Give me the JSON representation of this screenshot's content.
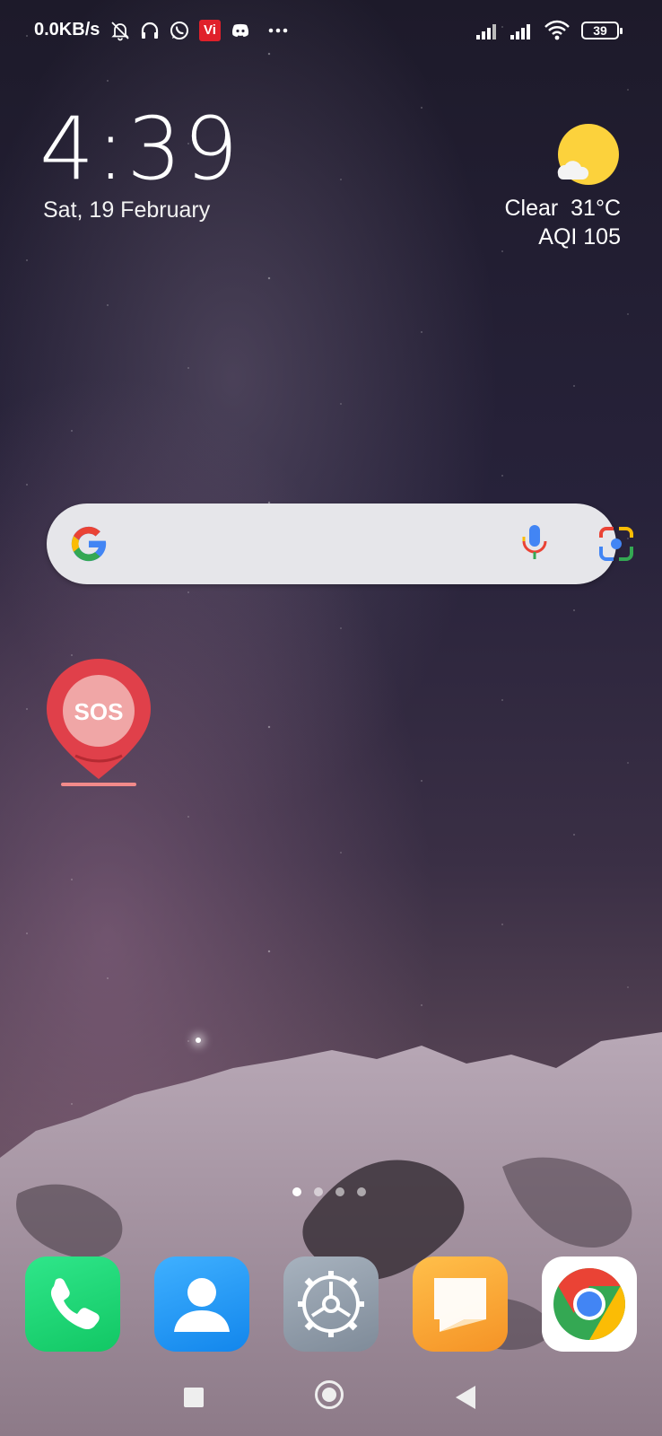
{
  "status_bar": {
    "net_speed": "0.0KB/s",
    "icons": [
      "mute-bell-icon",
      "headphones-icon",
      "whatsapp-icon",
      "vi-icon",
      "discord-icon",
      "more-icon"
    ],
    "right_icons": [
      "signal-1-icon",
      "signal-2-icon",
      "wifi-icon"
    ],
    "battery": "39",
    "vi_label": "Vi"
  },
  "clock": {
    "time": "4:39",
    "date": "Sat, 19 February"
  },
  "weather": {
    "condition": "Clear",
    "temperature": "31°C",
    "condition_line": "Clear  31°C",
    "aqi": "AQI 105",
    "icon": "sun-cloud-icon"
  },
  "search": {
    "icons": [
      "google-g-icon",
      "microphone-icon",
      "google-lens-icon"
    ]
  },
  "home_apps": [
    {
      "name": "sos-app",
      "label": "SOS"
    }
  ],
  "pages": {
    "count": 4,
    "active": 1
  },
  "dock": [
    {
      "name": "phone-app",
      "icon": "phone-icon"
    },
    {
      "name": "contacts-app",
      "icon": "contact-icon"
    },
    {
      "name": "settings-app",
      "icon": "gear-icon"
    },
    {
      "name": "notes-app",
      "icon": "note-icon"
    },
    {
      "name": "chrome-app",
      "icon": "chrome-icon"
    }
  ],
  "colors": {
    "sos_red": "#e0404a",
    "phone_green": "#1ed873",
    "contacts_blue": "#2a9cf8",
    "settings_gray": "#8e9aa8",
    "notes_orange": "#f8a83a",
    "sun_yellow": "#fcd23c"
  }
}
